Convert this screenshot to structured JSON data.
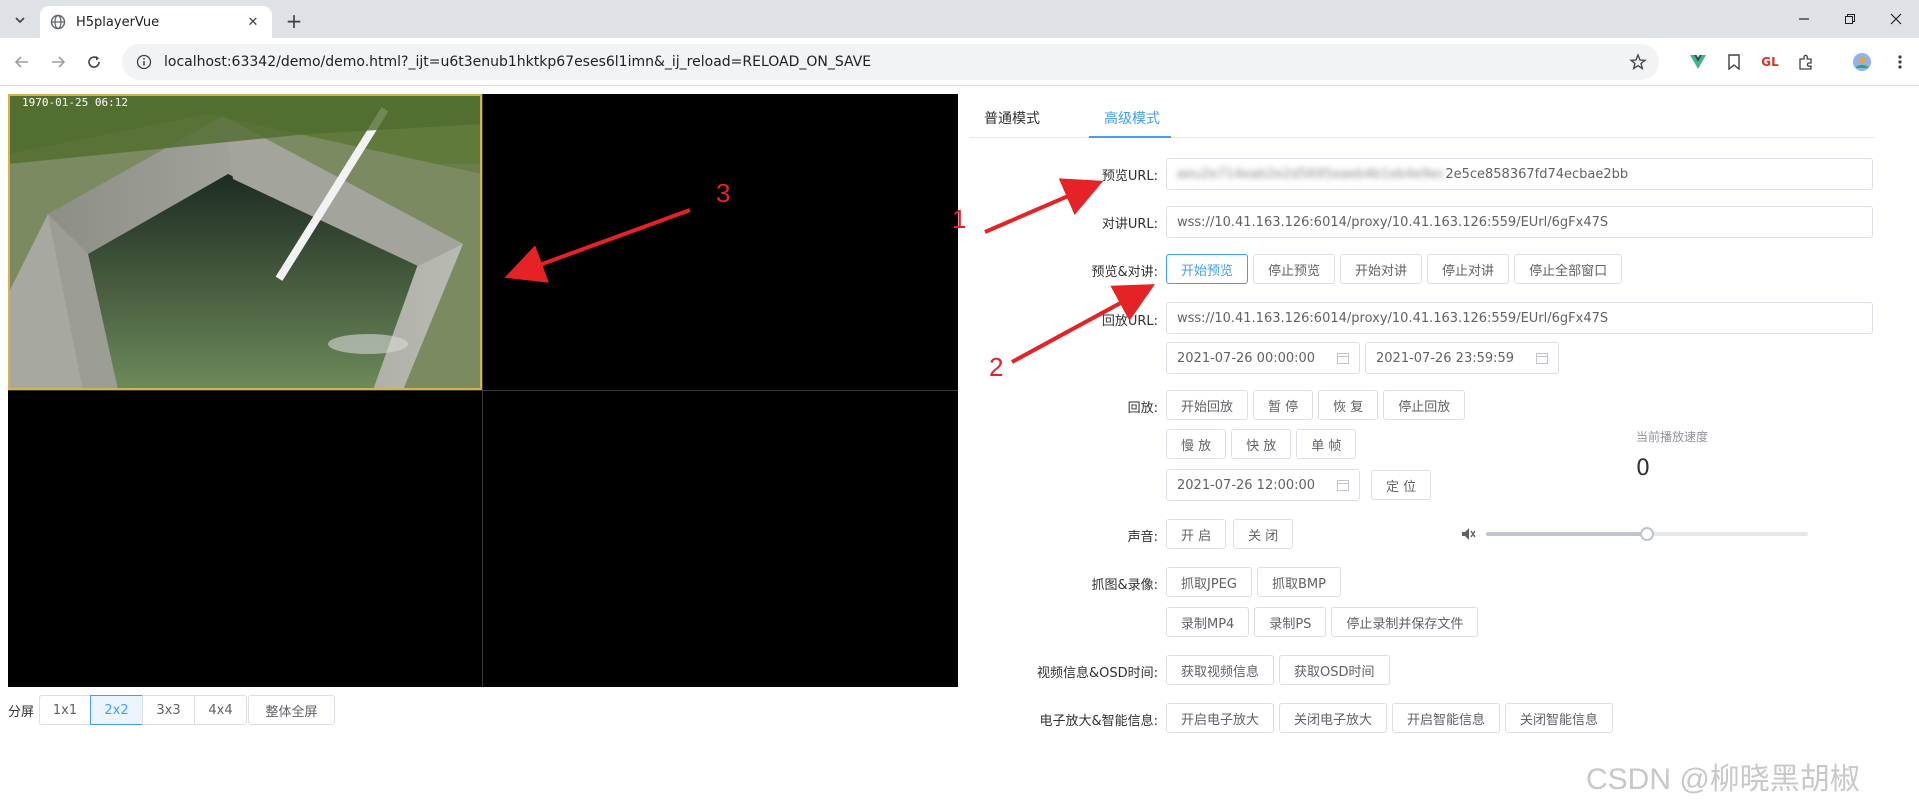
{
  "browser": {
    "tab_title": "H5playerVue",
    "url": "localhost:63342/demo/demo.html?_ijt=u6t3enub1hktkp67eses6l1imn&_ij_reload=RELOAD_ON_SAVE"
  },
  "player": {
    "osd_text": "1970-01-25  06:12",
    "split_label": "分屏",
    "split_options": [
      "1x1",
      "2x2",
      "3x3",
      "4x4"
    ],
    "split_selected": "2x2",
    "fullscreen_label": "整体全屏"
  },
  "tabs": {
    "normal": "普通模式",
    "advanced": "高级模式",
    "active": "高级模式"
  },
  "form": {
    "preview_url_label": "预览URL:",
    "preview_url_visible": "2e5ce858367fd74ecbae2bb",
    "preview_url_blurred": "aeu2e714eab2e2d5695eaeb4b1eb4e9ec",
    "talk_url_label": "对讲URL:",
    "talk_url": "wss://10.41.163.126:6014/proxy/10.41.163.126:559/EUrl/6gFx47S",
    "preview_talk_label": "预览&对讲:",
    "preview_talk_buttons": [
      "开始预览",
      "停止预览",
      "开始对讲",
      "停止对讲",
      "停止全部窗口"
    ],
    "playback_url_label": "回放URL:",
    "playback_url": "wss://10.41.163.126:6014/proxy/10.41.163.126:559/EUrl/6gFx47S",
    "start_date": "2021-07-26 00:00:00",
    "end_date": "2021-07-26 23:59:59",
    "playback_label": "回放:",
    "playback_buttons": [
      "开始回放",
      "暂 停",
      "恢 复",
      "停止回放"
    ],
    "speed_buttons": [
      "慢 放",
      "快 放",
      "单 帧"
    ],
    "seek_date": "2021-07-26 12:00:00",
    "seek_button": "定 位",
    "speed_label": "当前播放速度",
    "speed_value": "0",
    "sound_label": "声音:",
    "sound_buttons": [
      "开 启",
      "关 闭"
    ],
    "volume_level": 0.5,
    "capture_label": "抓图&录像:",
    "capture_buttons": [
      "抓取JPEG",
      "抓取BMP"
    ],
    "record_buttons": [
      "录制MP4",
      "录制PS",
      "停止录制并保存文件"
    ],
    "info_label": "视频信息&OSD时间:",
    "info_buttons": [
      "获取视频信息",
      "获取OSD时间"
    ],
    "zoom_label": "电子放大&智能信息:",
    "zoom_buttons": [
      "开启电子放大",
      "关闭电子放大",
      "开启智能信息",
      "关闭智能信息"
    ]
  },
  "annotations": {
    "num1": "1",
    "num2": "2",
    "num3": "3",
    "color": "#e52226"
  },
  "watermark": "CSDN @柳晓黑胡椒"
}
